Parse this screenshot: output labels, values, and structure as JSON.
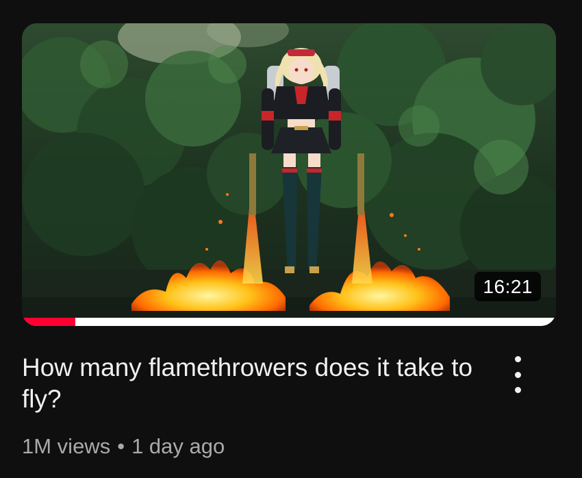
{
  "video": {
    "title": "How many flamethrowers does it take to fly?",
    "duration": "16:21",
    "watch_progress_fraction": 0.1,
    "views": "1M views",
    "separator": "•",
    "age": "1 day ago"
  },
  "icons": {
    "more": "more-vert-icon"
  },
  "colors": {
    "background": "#0f0f0f",
    "progress": "#ff0033",
    "progress_track": "#ffffff",
    "title": "#f1f1f1",
    "meta": "#aaaaaa"
  }
}
